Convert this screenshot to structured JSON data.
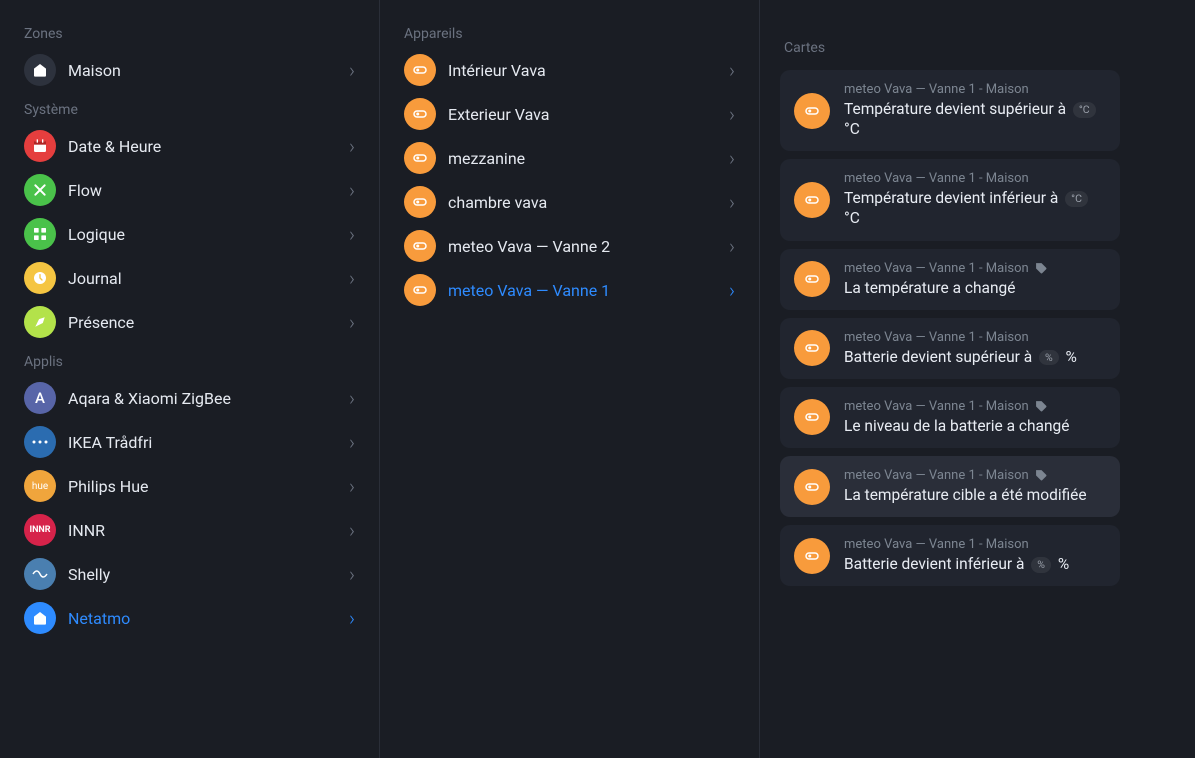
{
  "left": {
    "zones_header": "Zones",
    "zones": [
      {
        "label": "Maison",
        "icon": "home",
        "bg": "#2d323d"
      }
    ],
    "system_header": "Système",
    "system": [
      {
        "label": "Date & Heure",
        "icon": "calendar",
        "bg": "#e53e3e"
      },
      {
        "label": "Flow",
        "icon": "flow",
        "bg": "#4ac24a"
      },
      {
        "label": "Logique",
        "icon": "logic",
        "bg": "#4ac24a"
      },
      {
        "label": "Journal",
        "icon": "journal",
        "bg": "#f5c542"
      },
      {
        "label": "Présence",
        "icon": "presence",
        "bg": "#b3e24a"
      }
    ],
    "apps_header": "Applis",
    "apps": [
      {
        "label": "Aqara & Xiaomi ZigBee",
        "icon": "A",
        "bg": "#5865a8"
      },
      {
        "label": "IKEA Trådfri",
        "icon": "ikea",
        "bg": "#2b6cb0"
      },
      {
        "label": "Philips Hue",
        "icon": "hue",
        "bg": "#f0a53c"
      },
      {
        "label": "INNR",
        "icon": "innr",
        "bg": "#d6234a"
      },
      {
        "label": "Shelly",
        "icon": "shelly",
        "bg": "#4a7fb0"
      },
      {
        "label": "Netatmo",
        "icon": "netatmo",
        "bg": "#2e8bff",
        "active": true
      }
    ]
  },
  "mid": {
    "header": "Appareils",
    "devices": [
      {
        "label": "Intérieur Vava"
      },
      {
        "label": "Exterieur Vava"
      },
      {
        "label": "mezzanine"
      },
      {
        "label": "chambre vava"
      },
      {
        "label": "meteo Vava — Vanne 2"
      },
      {
        "label": "meteo Vava — Vanne 1",
        "active": true
      }
    ]
  },
  "right": {
    "header": "Cartes",
    "cards": [
      {
        "meta": "meteo Vava — Vanne 1 - Maison",
        "title_pre": "Température devient supérieur à ",
        "pill": "°C",
        "title_post": " °C"
      },
      {
        "meta": "meteo Vava — Vanne 1 - Maison",
        "title_pre": "Température devient inférieur à ",
        "pill": "°C",
        "title_post": " °C"
      },
      {
        "meta": "meteo Vava — Vanne 1 - Maison",
        "tag": true,
        "title_pre": "La température a changé"
      },
      {
        "meta": "meteo Vava — Vanne 1 - Maison",
        "title_pre": "Batterie devient supérieur à ",
        "pill": "%",
        "title_post": " %"
      },
      {
        "meta": "meteo Vava — Vanne 1 - Maison",
        "tag": true,
        "title_pre": "Le niveau de la batterie a changé"
      },
      {
        "meta": "meteo Vava — Vanne 1 - Maison",
        "tag": true,
        "title_pre": "La température cible a été modifiée",
        "highlight": true
      },
      {
        "meta": "meteo Vava — Vanne 1 - Maison",
        "title_pre": "Batterie devient inférieur à ",
        "pill": "%",
        "title_post": " %"
      }
    ]
  }
}
